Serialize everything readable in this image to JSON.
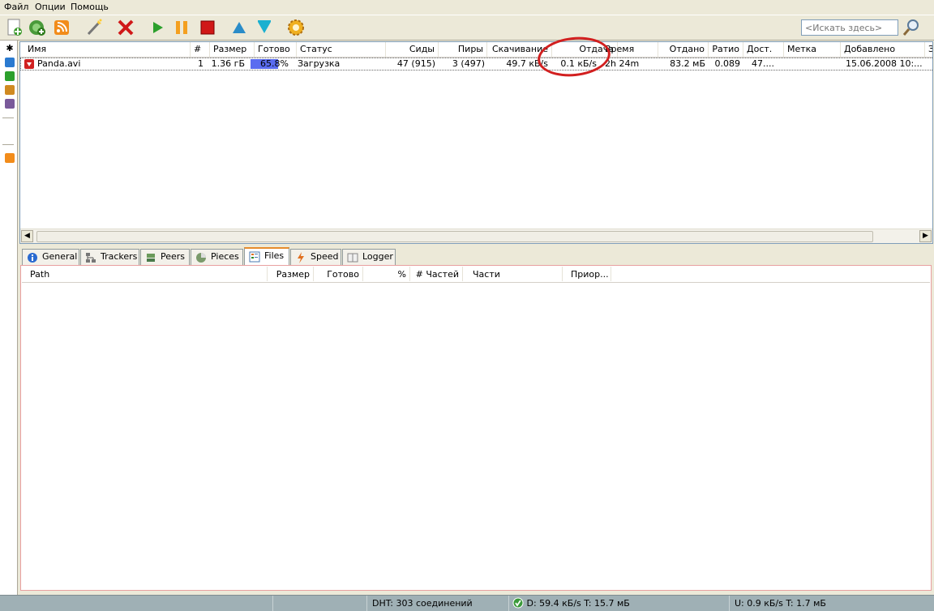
{
  "menu": [
    "Файл",
    "Опции",
    "Помощь"
  ],
  "toolbar": {
    "buttons": [
      "add-torrent-icon",
      "add-url-icon",
      "rss-icon",
      "create-torrent-icon",
      "remove-icon",
      "start-icon",
      "pause-icon",
      "stop-icon",
      "move-up-icon",
      "move-down-icon",
      "preferences-icon"
    ]
  },
  "search": {
    "placeholder": "<Искать здесь>"
  },
  "list": {
    "columns": [
      "Имя",
      "#",
      "Размер",
      "Готово",
      "Статус",
      "Сиды",
      "Пиры",
      "Скачивание",
      "Отдача",
      "Время",
      "Отдано",
      "Ратио",
      "Дост.",
      "Метка",
      "Добавлено",
      "З"
    ],
    "rows": [
      {
        "name": "Panda.avi",
        "num": "1",
        "size": "1.36 гБ",
        "done_pct": "65.8%",
        "done_fraction": 0.658,
        "status": "Загрузка",
        "seeds": "47 (915)",
        "peers": "3 (497)",
        "down": "49.7 кБ/s",
        "up": "0.1 кБ/s",
        "eta": "2h 24m",
        "uploaded": "83.2 мБ",
        "ratio": "0.089",
        "avail": "47....",
        "label": "",
        "added": "15.06.2008 10:..."
      }
    ]
  },
  "tabs": [
    "General",
    "Trackers",
    "Peers",
    "Pieces",
    "Files",
    "Speed",
    "Logger"
  ],
  "active_tab": "Files",
  "files_columns": [
    "Path",
    "Размер",
    "Готово",
    "%",
    "# Частей",
    "Части",
    "Приор..."
  ],
  "status": {
    "dht": "DHT: 303 соединений",
    "download": "D: 59.4 кБ/s T: 15.7 мБ",
    "upload": "U: 0.9 кБ/s T: 1.7 мБ"
  },
  "colors": {
    "progress": "#5a6cf0",
    "callout": "#d21f1f"
  }
}
